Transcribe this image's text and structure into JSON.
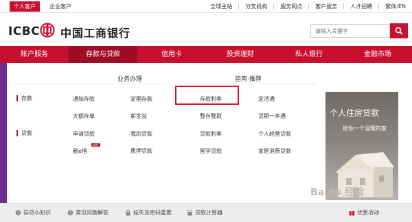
{
  "top_bar": {
    "tabs": [
      "个人客户",
      "企业客户"
    ],
    "links": [
      "全球主站",
      "分支机构",
      "服务网点",
      "客户服务",
      "人才招聘",
      "繁体/EN"
    ]
  },
  "header": {
    "logo_text": "ICBC",
    "logo_cn": "中国工商银行",
    "search_placeholder": "请输入关键字"
  },
  "nav": [
    "账户服务",
    "存款与贷款",
    "信用卡",
    "投资理财",
    "私人银行",
    "金融市场"
  ],
  "panel": {
    "section1_title": "业务办理",
    "section2_title": "指南·推荐",
    "cat_deposit": "存款",
    "cat_loan": "贷款",
    "deposit_items": [
      "通知存款",
      "定期存款",
      "大额存单",
      "薪金溢"
    ],
    "loan_items": [
      "申请贷款",
      "我的贷款",
      "融e借",
      "质押贷款"
    ],
    "hot_badge": "HOT",
    "guide_col1": [
      "存款利率",
      "整存整取",
      "贷款利率",
      "留学贷款"
    ],
    "guide_col2": [
      "定活通",
      "活期一本通",
      "个人经营贷款",
      "家居消费贷款"
    ]
  },
  "ad": {
    "title": "个人住房贷款",
    "subtitle": "给你一个温暖的家"
  },
  "footer": [
    "存贷小知识",
    "常见问题解答",
    "挂失及密码重置",
    "贷款计算器",
    "优惠活动"
  ],
  "watermark": "Baidu 经验",
  "colors": {
    "brand_red": "#c8102e",
    "nav_active": "#9e0b22",
    "highlight": "#e0102a"
  }
}
